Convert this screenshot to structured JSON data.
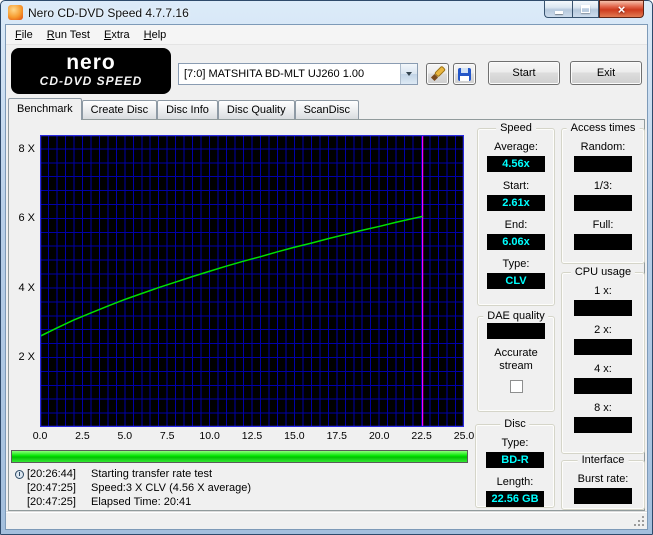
{
  "window": {
    "title": "Nero CD-DVD Speed 4.7.7.16",
    "controls": {
      "minimize": "minimize",
      "maximize": "maximize",
      "close": "close"
    }
  },
  "menu": {
    "items": [
      "File",
      "Run Test",
      "Extra",
      "Help"
    ]
  },
  "header": {
    "logo_line1": "nero",
    "logo_line2": "CD-DVD SPEED",
    "drive": "[7:0] MATSHITA BD-MLT UJ260 1.00",
    "start_label": "Start",
    "exit_label": "Exit"
  },
  "icons": {
    "app": "nero-flame-icon",
    "combo_arrow": "chevron-down-icon",
    "tool1": "brush-icon",
    "tool2": "save-floppy-icon",
    "log_first_line": "clock-icon"
  },
  "tabs": [
    {
      "label": "Benchmark",
      "active": true
    },
    {
      "label": "Create Disc",
      "active": false
    },
    {
      "label": "Disc Info",
      "active": false
    },
    {
      "label": "Disc Quality",
      "active": false
    },
    {
      "label": "ScanDisc",
      "active": false
    }
  ],
  "chart_data": {
    "type": "line",
    "title": "",
    "xlabel": "",
    "ylabel": "",
    "xlim": [
      0,
      25
    ],
    "ylim": [
      0,
      8.4
    ],
    "x_ticks": [
      0.0,
      2.5,
      5.0,
      7.5,
      10.0,
      12.5,
      15.0,
      17.5,
      20.0,
      22.5,
      25.0
    ],
    "y_ticks": [
      {
        "value": 8,
        "label": "8 X"
      },
      {
        "value": 6,
        "label": "6 X"
      },
      {
        "value": 4,
        "label": "4 X"
      },
      {
        "value": 2,
        "label": "2 X"
      }
    ],
    "grid": {
      "x_step": 0.5,
      "y_step": 0.4,
      "color": "#0000a8",
      "border_color": "#2a2ae0"
    },
    "plot_bg": "#000000",
    "legend": "off",
    "series": [
      {
        "name": "read-transfer-rate",
        "color": "#00e000",
        "x": [
          0,
          1,
          2,
          3,
          4,
          5,
          6,
          7,
          8,
          9,
          10,
          11,
          12,
          13,
          14,
          15,
          16,
          17,
          18,
          19,
          20,
          21,
          22,
          22.56
        ],
        "y": [
          2.61,
          2.85,
          3.08,
          3.28,
          3.48,
          3.67,
          3.84,
          4.01,
          4.17,
          4.33,
          4.48,
          4.63,
          4.77,
          4.9,
          5.04,
          5.17,
          5.29,
          5.42,
          5.54,
          5.66,
          5.77,
          5.89,
          6.0,
          6.06
        ]
      }
    ],
    "marker_line": {
      "x": 22.56,
      "color": "#ff00ff"
    }
  },
  "panels": {
    "speed": {
      "title": "Speed",
      "fields": [
        {
          "label": "Average:",
          "value": "4.56x"
        },
        {
          "label": "Start:",
          "value": "2.61x"
        },
        {
          "label": "End:",
          "value": "6.06x"
        },
        {
          "label": "Type:",
          "value": "CLV"
        }
      ]
    },
    "access_times": {
      "title": "Access times",
      "fields": [
        {
          "label": "Random:",
          "value": ""
        },
        {
          "label": "1/3:",
          "value": ""
        },
        {
          "label": "Full:",
          "value": ""
        }
      ]
    },
    "dae": {
      "title": "DAE quality",
      "value": "",
      "accurate_stream_label": "Accurate stream",
      "accurate_stream_checked": false
    },
    "cpu": {
      "title": "CPU usage",
      "fields": [
        {
          "label": "1 x:",
          "value": ""
        },
        {
          "label": "2 x:",
          "value": ""
        },
        {
          "label": "4 x:",
          "value": ""
        },
        {
          "label": "8 x:",
          "value": ""
        }
      ]
    },
    "disc": {
      "title": "Disc",
      "fields": [
        {
          "label": "Type:",
          "value": "BD-R"
        },
        {
          "label": "Length:",
          "value": "22.56 GB"
        }
      ]
    },
    "interface": {
      "title": "Interface",
      "fields": [
        {
          "label": "Burst rate:",
          "value": ""
        }
      ]
    }
  },
  "progress": {
    "percent": 100,
    "color": "#00e400"
  },
  "log": {
    "lines": [
      {
        "time": "[20:26:44]",
        "text": "Starting transfer rate test",
        "icon": "clock-icon"
      },
      {
        "time": "[20:47:25]",
        "text": "Speed:3 X CLV (4.56 X average)",
        "icon": ""
      },
      {
        "time": "[20:47:25]",
        "text": "Elapsed Time: 20:41",
        "icon": ""
      }
    ]
  }
}
